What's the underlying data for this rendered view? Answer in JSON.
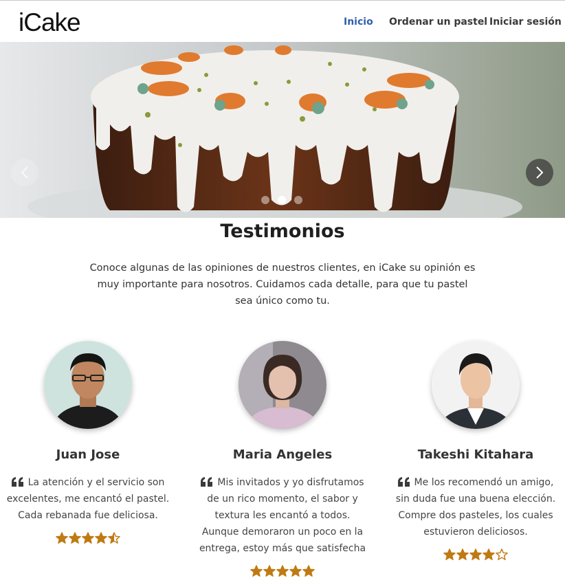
{
  "navbar": {
    "brand": "iCake",
    "links": [
      {
        "label": "Inicio",
        "active": true
      },
      {
        "label": "Ordenar un pastel",
        "active": false
      },
      {
        "label": "Iniciar sesión",
        "active": false
      }
    ]
  },
  "carousel": {
    "slides": 3,
    "active_slide": 2,
    "prev_icon": "chevron-left-icon",
    "next_icon": "chevron-right-icon"
  },
  "testimonials": {
    "title": "Testimonios",
    "intro": "Conoce algunas de las opiniones de nuestros clientes, en iCake su opinión es muy importante para nosotros. Cuidamos cada detalle, para que tu pastel sea único como tu.",
    "items": [
      {
        "name": "Juan Jose",
        "quote": "La atención y el servicio son excelentes, me encantó el pastel. Cada rebanada fue deliciosa.",
        "rating": 4.5
      },
      {
        "name": "Maria Angeles",
        "quote": "Mis invitados y yo disfrutamos de un rico momento, el sabor y textura les encantó a todos. Aunque demoraron un poco en la entrega, estoy más que satisfecha",
        "rating": 5
      },
      {
        "name": "Takeshi Kitahara",
        "quote": "Me los recomendó un amigo, sin duda fue una buena elección. Compre dos pasteles, los cuales estuvieron deliciosos.",
        "rating": 4
      }
    ]
  },
  "colors": {
    "nav_active": "#2f5fad",
    "star": "#c07a12"
  }
}
